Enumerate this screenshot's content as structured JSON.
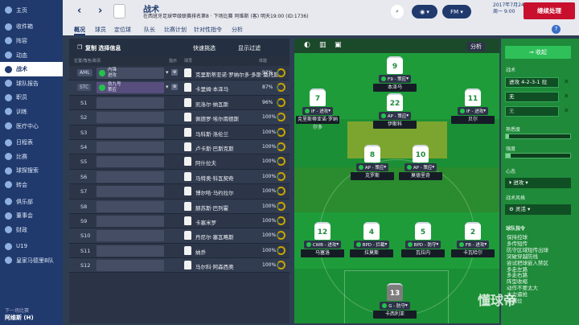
{
  "sidebar": {
    "items": [
      {
        "label": "主页"
      },
      {
        "label": "收件箱"
      },
      {
        "label": "阵容"
      },
      {
        "label": "动态"
      },
      {
        "label": "战术",
        "active": true
      },
      {
        "label": "球队报告"
      },
      {
        "label": "职员"
      },
      {
        "label": "训练"
      },
      {
        "label": "医疗中心"
      },
      {
        "label": "日程表"
      },
      {
        "label": "比赛"
      },
      {
        "label": "球探搜索"
      },
      {
        "label": "转会"
      },
      {
        "label": "俱乐部"
      },
      {
        "label": "董事会"
      },
      {
        "label": "财政"
      },
      {
        "label": "U19"
      },
      {
        "label": "皇家马德里B队"
      }
    ],
    "footer_small": "下一场比赛",
    "footer_name": "阿维斯 (H)"
  },
  "topbar": {
    "title": "战术",
    "subtitle": "在西班牙足球甲级联赛排名第8 · 下场比赛 阿维斯 (客) 明天19:00 (ID:1736)",
    "date_line1": "2017年7月24",
    "date_line2": "周一 9:00",
    "continue_label": "继续处理"
  },
  "tabs": [
    "概况",
    "球员",
    "定位球",
    "队长",
    "比赛计划",
    "针对性指令",
    "分析"
  ],
  "left_panel": {
    "copy_label": "复制 选择信息",
    "quick_label": "快速挑选",
    "filter_label": "显示过滤",
    "col_pos": "位置/角色/职责",
    "col_ind": "指示",
    "col_player": "球员",
    "col_cond": "体能"
  },
  "rows": [
    {
      "pos": "AML",
      "role1": "内锋",
      "role2": "进攻",
      "player": "克里斯蒂亚诺·罗纳尔多·多斯·桑托斯",
      "cond": "92%",
      "tag": true
    },
    {
      "pos": "STC",
      "role1": "伪九号",
      "role2": "策应",
      "player": "卡里姆·本泽马",
      "cond": "87%",
      "tag": true,
      "hl": true
    },
    {
      "pos": "S1",
      "player": "凯洛尔·纳瓦斯",
      "cond": "96%"
    },
    {
      "pos": "S2",
      "player": "佩德罗·埃尔南德斯",
      "cond": "100%"
    },
    {
      "pos": "S3",
      "player": "马科斯·洛伦兰",
      "cond": "100%"
    },
    {
      "pos": "S4",
      "player": "卢卡斯·巴斯克斯",
      "cond": "100%"
    },
    {
      "pos": "S5",
      "player": "阿什拉夫",
      "cond": "100%"
    },
    {
      "pos": "S6",
      "player": "马特奥·科瓦契奇",
      "cond": "100%"
    },
    {
      "pos": "S7",
      "player": "博尔哈·马约拉尔",
      "cond": "100%"
    },
    {
      "pos": "S8",
      "player": "赫苏斯·巴列霍",
      "cond": "100%"
    },
    {
      "pos": "S9",
      "player": "卡塞米罗",
      "cond": "100%"
    },
    {
      "pos": "S10",
      "player": "丹尼尔·塞瓦略斯",
      "cond": "100%"
    },
    {
      "pos": "S11",
      "player": "纳乔",
      "cond": "100%"
    },
    {
      "pos": "S12",
      "player": "马尔科·阿森西奥",
      "cond": "100%"
    }
  ],
  "pitch": {
    "analysis_label": "分析",
    "players": [
      {
        "num": "9",
        "role": "F9 - 策应",
        "name": "本泽马"
      },
      {
        "num": "7",
        "role": "IF - 进攻",
        "name": "克里斯蒂亚诺·罗纳尔多"
      },
      {
        "num": "22",
        "role": "AP - 策应",
        "name": "伊斯科"
      },
      {
        "num": "11",
        "role": "IF - 进攻",
        "name": "贝尔"
      },
      {
        "num": "8",
        "role": "AP - 策应",
        "name": "克罗斯"
      },
      {
        "num": "10",
        "role": "AP - 策应",
        "name": "莫德里奇"
      },
      {
        "num": "12",
        "role": "CWB - 进攻",
        "name": "马塞洛"
      },
      {
        "num": "4",
        "role": "BPD - 拦截",
        "name": "拉莫斯"
      },
      {
        "num": "5",
        "role": "BPD - 防守",
        "name": "瓦拉内"
      },
      {
        "num": "2",
        "role": "FB - 进攻",
        "name": "卡瓦哈尔"
      },
      {
        "num": "13",
        "role": "G - 防守",
        "name": "卡西利亚"
      }
    ]
  },
  "right_panel": {
    "collapse_label": "收起",
    "tactic_label": "战术",
    "formation": "进攻 4-2-3-1 拉",
    "slot2": "无",
    "slot3": "无",
    "familiarity_label": "熟悉度",
    "intensity_label": "强度",
    "mentality_label": "心态",
    "mentality_value": "进攻",
    "style_label": "战术风格",
    "style_value": "灵活",
    "instructions_label": "球队指令",
    "instructions": [
      "保持控球",
      "多传短传",
      "防守区域短传出球",
      "突破穿越防线",
      "尝试把球嵌入禁区",
      "多走左路",
      "多走右路",
      "阵型收缩",
      "动作不要太大",
      "大力逼抢",
      "造越位"
    ],
    "familiarity_fill": 0.05,
    "intensity_fill": 0.08
  },
  "watermark": "懂球帝",
  "colors": {
    "sidebar": "#203a6e",
    "pitch": "#1e9c3a",
    "continue": "#c8102e",
    "accent": "#2fc05a"
  }
}
